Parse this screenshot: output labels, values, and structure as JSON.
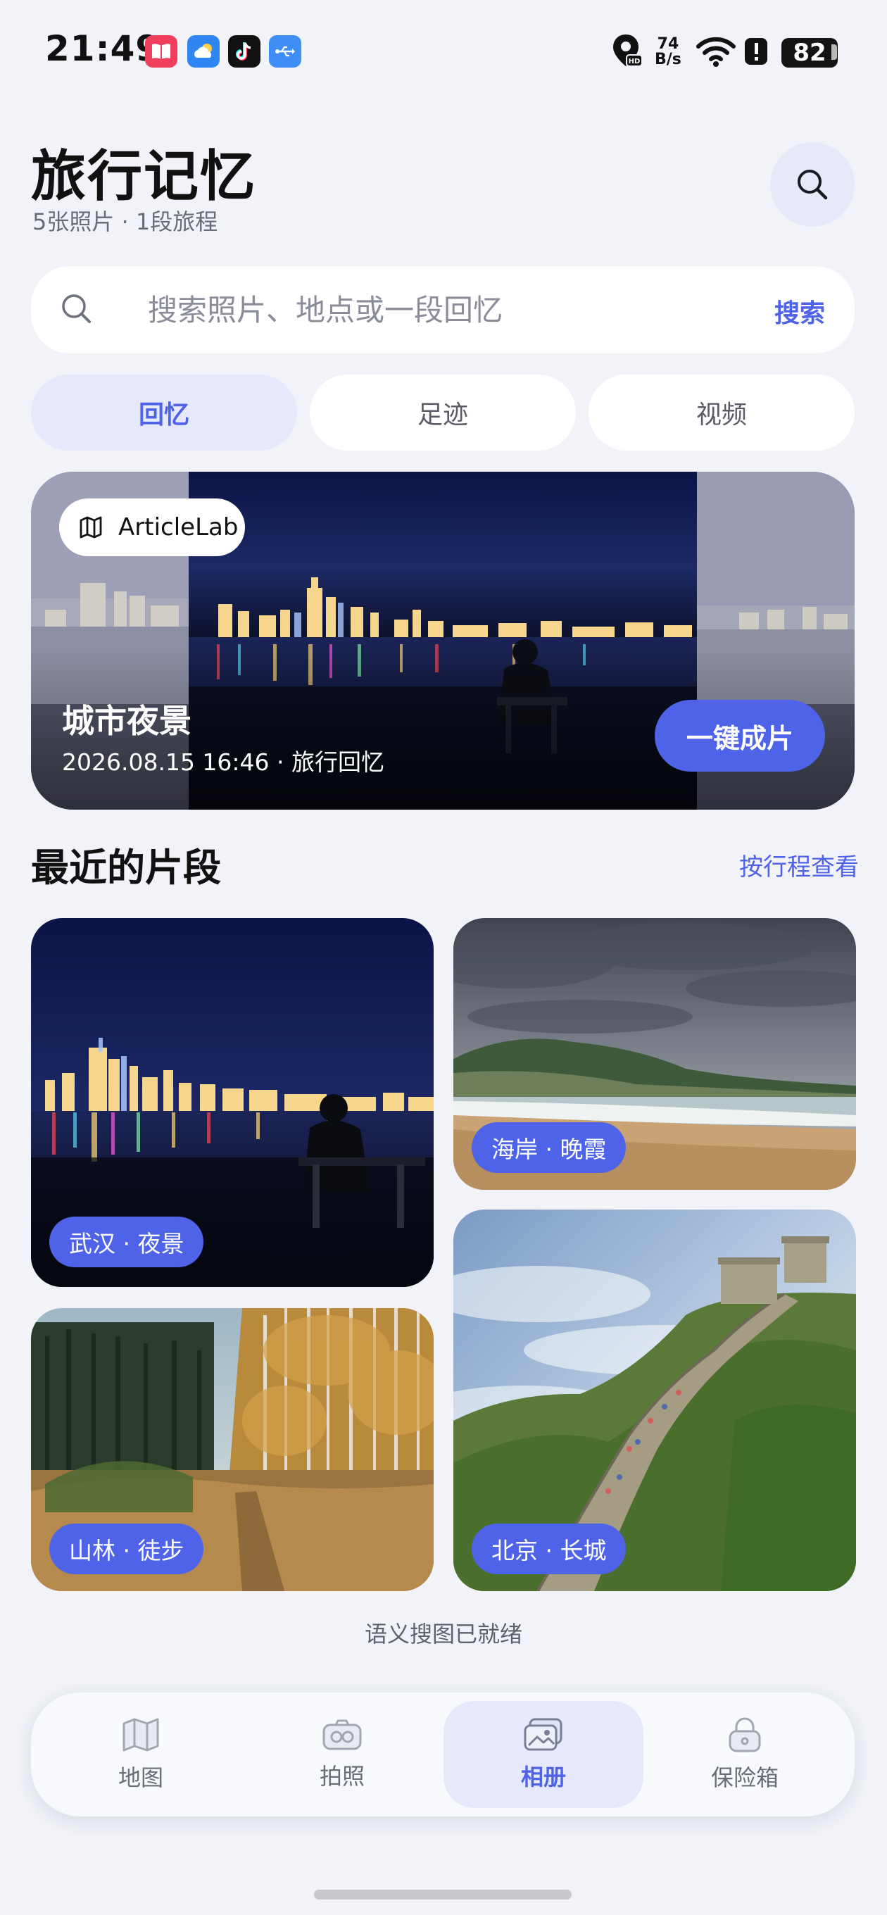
{
  "status_bar": {
    "time": "21:49",
    "net_speed_value": "74",
    "net_speed_unit": "B/s",
    "battery": "82",
    "app_icons": [
      "reader-app-icon",
      "weather-app-icon",
      "tiktok-app-icon",
      "usb-icon"
    ],
    "status_icons": [
      "location-hd-icon",
      "wifi-icon",
      "alert-icon"
    ]
  },
  "header": {
    "title": "旅行记忆",
    "subtitle": "5张照片 · 1段旅程",
    "search_icon": "search-icon"
  },
  "search": {
    "placeholder": "搜索照片、地点或一段回忆",
    "submit_label": "搜索"
  },
  "tabs": [
    {
      "label": "回忆",
      "active": true
    },
    {
      "label": "足迹",
      "active": false
    },
    {
      "label": "视频",
      "active": false
    }
  ],
  "hero": {
    "tag_icon": "map-icon",
    "tag_label": "ArticleLab",
    "title": "城市夜景",
    "meta": "2026.08.15 16:46 · 旅行回忆",
    "cta_label": "一键成片"
  },
  "recent": {
    "title": "最近的片段",
    "link_label": "按行程查看",
    "items": [
      {
        "label": "武汉 · 夜景",
        "scene": "city-night"
      },
      {
        "label": "海岸 · 晚霞",
        "scene": "coast"
      },
      {
        "label": "山林 · 徒步",
        "scene": "forest"
      },
      {
        "label": "北京 · 长城",
        "scene": "great-wall"
      }
    ]
  },
  "ready_note": "语义搜图已就绪",
  "bottom_nav": [
    {
      "label": "地图",
      "icon": "map-icon",
      "active": false
    },
    {
      "label": "拍照",
      "icon": "camera-icon",
      "active": false
    },
    {
      "label": "相册",
      "icon": "gallery-icon",
      "active": true
    },
    {
      "label": "保险箱",
      "icon": "lock-icon",
      "active": false
    }
  ],
  "colors": {
    "accent": "#4f63e8",
    "background": "#f1f3f8",
    "active_tab_bg": "#e6e9fb"
  }
}
